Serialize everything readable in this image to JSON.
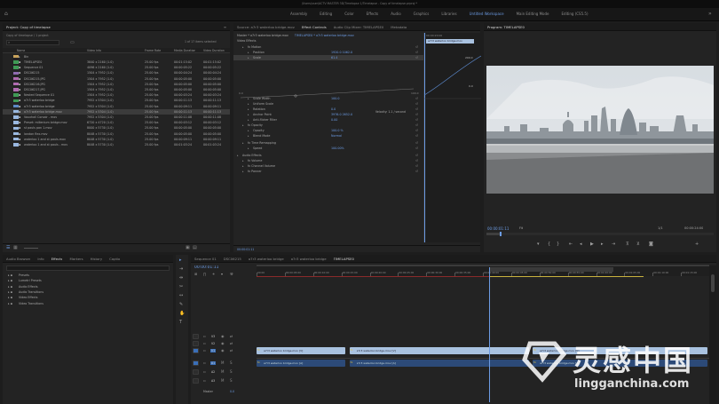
{
  "os_title": "/Users/user/ACTV MASTER 3D/Timelapse 1/Timelapse - Copy of timelapse.prproj *",
  "workspaces": [
    "Assembly",
    "Editing",
    "Color",
    "Effects",
    "Audio",
    "Graphics",
    "Libraries",
    "Untitled Workspace",
    "Main Editing Mode",
    "Editing (CS5.5)"
  ],
  "active_workspace": "Untitled Workspace",
  "project": {
    "title": "Project: Copy of timelapse",
    "subtitle": "Copy of timelapse / 1 project",
    "search_placeholder": "",
    "items_selected": "1 of 17 items selected",
    "columns": [
      "Name",
      "Video Info",
      "Frame Rate",
      "Media Duration",
      "Video Duration"
    ],
    "items": [
      {
        "name": "Bin",
        "info": "",
        "rate": "",
        "mdur": "",
        "vdur": "",
        "color": "#c9a35c"
      },
      {
        "name": "TIMELAPSE0",
        "info": "3840 x 2160 (1.0)",
        "rate": "25.00 fps",
        "mdur": "00:01:15:02",
        "vdur": "00:01:15:02",
        "color": "#3f9a55"
      },
      {
        "name": "Sequence 01",
        "info": "4096 x 2160 (1.0)",
        "rate": "25.00 fps",
        "mdur": "00:00:05:22",
        "vdur": "00:00:05:22",
        "color": "#3f9a55"
      },
      {
        "name": "DSC06215",
        "info": "1504 x 7952 (1.0)",
        "rate": "25.00 fps",
        "mdur": "00:00:04:24",
        "vdur": "00:00:04:24",
        "color": "#8f6bb0"
      },
      {
        "name": "DSC06215.JPG",
        "info": "1504 x 7952 (1.0)",
        "rate": "25.00 fps",
        "mdur": "00:00:05:00",
        "vdur": "00:00:05:00",
        "color": "#b06bb0"
      },
      {
        "name": "DSC06216.JPG",
        "info": "1504 x 7952 (1.0)",
        "rate": "25.00 fps",
        "mdur": "00:00:05:00",
        "vdur": "00:00:05:00",
        "color": "#b06bb0"
      },
      {
        "name": "DSC06217.JPG",
        "info": "1504 x 7952 (1.0)",
        "rate": "25.00 fps",
        "mdur": "00:00:05:00",
        "vdur": "00:00:05:00",
        "color": "#b06bb0"
      },
      {
        "name": "Nested Sequence 01",
        "info": "1504 x 7952 (1.0)",
        "rate": "25.00 fps",
        "mdur": "00:00:03:24",
        "vdur": "00:00:03:24",
        "color": "#3f9a55"
      },
      {
        "name": "a7r3 waterloo bridge",
        "info": "7952 x 5304 (1.0)",
        "rate": "25.00 fps",
        "mdur": "00:00:11:13",
        "vdur": "00:00:11:13",
        "color": "#3f9a55"
      },
      {
        "name": "a7r3 waterloo bridge",
        "info": "7952 x 5304 (1.0)",
        "rate": "25.00 fps",
        "mdur": "00:00:09:11",
        "vdur": "00:00:09:11",
        "color": "#5d89c4"
      },
      {
        "name": "a7r3 waterloo bridge.mov",
        "info": "7952 x 5304 (1.0)",
        "rate": "25.00 fps",
        "mdur": "00:00:11:13",
        "vdur": "00:00:11:13",
        "color": "#9ab8e0",
        "selected": true
      },
      {
        "name": "Vauxhall Corsair - mov",
        "info": "7952 x 5304 (1.0)",
        "rate": "25.00 fps",
        "mdur": "00:00:11:08",
        "vdur": "00:00:11:08",
        "color": "#9ab8e0"
      },
      {
        "name": "Preset: millenium bridge.mov",
        "info": "6720 x 4720 (1.0)",
        "rate": "25.00 fps",
        "mdur": "00:00:03:12",
        "vdur": "00:00:03:12",
        "color": "#9ab8e0"
      },
      {
        "name": "st pauls pan 1.mov",
        "info": "8000 x 5730 (1.0)",
        "rate": "25.00 fps",
        "mdur": "00:00:05:00",
        "vdur": "00:00:05:00",
        "color": "#9ab8e0"
      },
      {
        "name": "london flex.mov",
        "info": "8048 x 5730 (1.0)",
        "rate": "25.00 fps",
        "mdur": "00:00:05:00",
        "vdur": "00:00:05:00",
        "color": "#9ab8e0"
      },
      {
        "name": "waterloo 1 and st pauls.mov",
        "info": "8048 x 5730 (1.0)",
        "rate": "25.00 fps",
        "mdur": "00:00:09:11",
        "vdur": "00:00:09:11",
        "color": "#9ab8e0"
      },
      {
        "name": "waterloo 1 and st pauls - mov",
        "info": "8048 x 5730 (1.0)",
        "rate": "25.00 fps",
        "mdur": "00:01:03:24",
        "vdur": "00:01:03:24",
        "color": "#9ab8e0"
      }
    ]
  },
  "effect_controls": {
    "tabs": [
      "Source: a7r3 waterloo bridge.mov",
      "Effect Controls",
      "Audio Clip Mixer: TIMELAPSE0",
      "Metadata"
    ],
    "active_tab": "Effect Controls",
    "source_line": "Master * a7r3 waterloo bridge.mov",
    "seq_line": "TIMELAPSE0 * a7r3 waterloo bridge.mov",
    "clip_label": "a7r3 waterloo bridge.mov",
    "section_video": "Video Effects",
    "params": [
      {
        "name": "fx  Motion",
        "value": "",
        "indent": 1
      },
      {
        "name": "Position",
        "value": "1920.0   1062.0",
        "indent": 2
      },
      {
        "name": "Scale",
        "value": "61.4",
        "indent": 2,
        "highlight": true
      },
      {
        "name": "Scale Width",
        "value": "100.0",
        "indent": 2
      },
      {
        "name": "Uniform Scale",
        "value": "",
        "indent": 2
      },
      {
        "name": "Rotation",
        "value": "0.0",
        "indent": 2
      },
      {
        "name": "Anchor Point",
        "value": "3976.0   2652.0",
        "indent": 2
      },
      {
        "name": "Anti-flicker Filter",
        "value": "0.00",
        "indent": 2
      },
      {
        "name": "fx  Opacity",
        "value": "",
        "indent": 1
      },
      {
        "name": "Opacity",
        "value": "100.0 %",
        "indent": 2
      },
      {
        "name": "Blend Mode",
        "value": "Normal",
        "indent": 2
      },
      {
        "name": "fx  Time Remapping",
        "value": "",
        "indent": 1
      },
      {
        "name": "Speed",
        "value": "100.00%",
        "indent": 2
      },
      {
        "name": "Audio Effects",
        "value": "",
        "indent": 0
      },
      {
        "name": "fx  Volume",
        "value": "",
        "indent": 1
      },
      {
        "name": "fx  Channel Volume",
        "value": "",
        "indent": 1
      },
      {
        "name": "fx  Panner",
        "value": "",
        "indent": 1
      }
    ],
    "scale_min": "0.0",
    "scale_max": "100.0",
    "velocity": "Velocity: 1.1 / second",
    "graph_top": "200.0",
    "graph_bottom": "0.0",
    "timecode": "00:00:01:11",
    "ruler": "00:00:20:00"
  },
  "program": {
    "title": "Program: TIMELAPSE0",
    "timecode": "00:00:01:11",
    "fit": "Fit",
    "fraction": "1/1",
    "duration": "00:00:24:00",
    "progress": 0.06
  },
  "effects_panel": {
    "tabs": [
      "Audio Browser",
      "Info",
      "Effects",
      "Markers",
      "History",
      "Captio"
    ],
    "active_tab": "Effects",
    "items": [
      "Presets",
      "Lumetri Presets",
      "Audio Effects",
      "Audio Transitions",
      "Video Effects",
      "Video Transitions"
    ]
  },
  "timeline": {
    "tabs": [
      "Sequence 01",
      "DSC06215",
      "a7r3 waterloo bridge",
      "a7r3 waterloo bridge",
      "TIMELAPSE0"
    ],
    "active_tab": "TIMELAPSE0",
    "timecode": "00:00:01:11",
    "ruler": [
      "00:00",
      "00:00:05:00",
      "00:00:10:00",
      "00:00:15:00",
      "00:00:20:00",
      "00:00:25:00",
      "00:00:30:00",
      "00:00:35:00",
      "00:00:40:00",
      "00:00:45:00",
      "00:00:50:00",
      "00:00:55:00",
      "00:01:00:00",
      "00:01:05:00",
      "00:01:10:00",
      "00:01:15:00"
    ],
    "tracks": [
      "V3",
      "V2",
      "V1",
      "A1",
      "A2",
      "A3"
    ],
    "master_label": "Master",
    "master_value": "0.0",
    "clips": [
      {
        "label": "a7r3 waterloo bridge.mov [V]",
        "start": 0,
        "len": 0.2,
        "track": "V1"
      },
      {
        "label": "a7r3 waterloo bridge.mov [V]",
        "start": 0.205,
        "len": 0.4,
        "track": "V1"
      },
      {
        "label": "a7r3 waterloo bridge.mov [V]",
        "start": 0.61,
        "len": 0.39,
        "track": "V1"
      },
      {
        "label": "a7r3 waterloo bridge.mov [A]",
        "start": 0,
        "len": 0.2,
        "track": "A1"
      },
      {
        "label": "a7r3 waterloo bridge.mov [A]",
        "start": 0.205,
        "len": 0.4,
        "track": "A1"
      },
      {
        "label": "a7r3 waterloo bridge.mov [A]",
        "start": 0.61,
        "len": 0.39,
        "track": "A1"
      }
    ]
  },
  "watermark": {
    "cn": "灵感中国",
    "url": "lingganchina.com"
  },
  "colors": {
    "accent": "#6c9be3",
    "panel": "#232323",
    "selected": "#3b3b3b",
    "clip": "#a9c2e0"
  }
}
